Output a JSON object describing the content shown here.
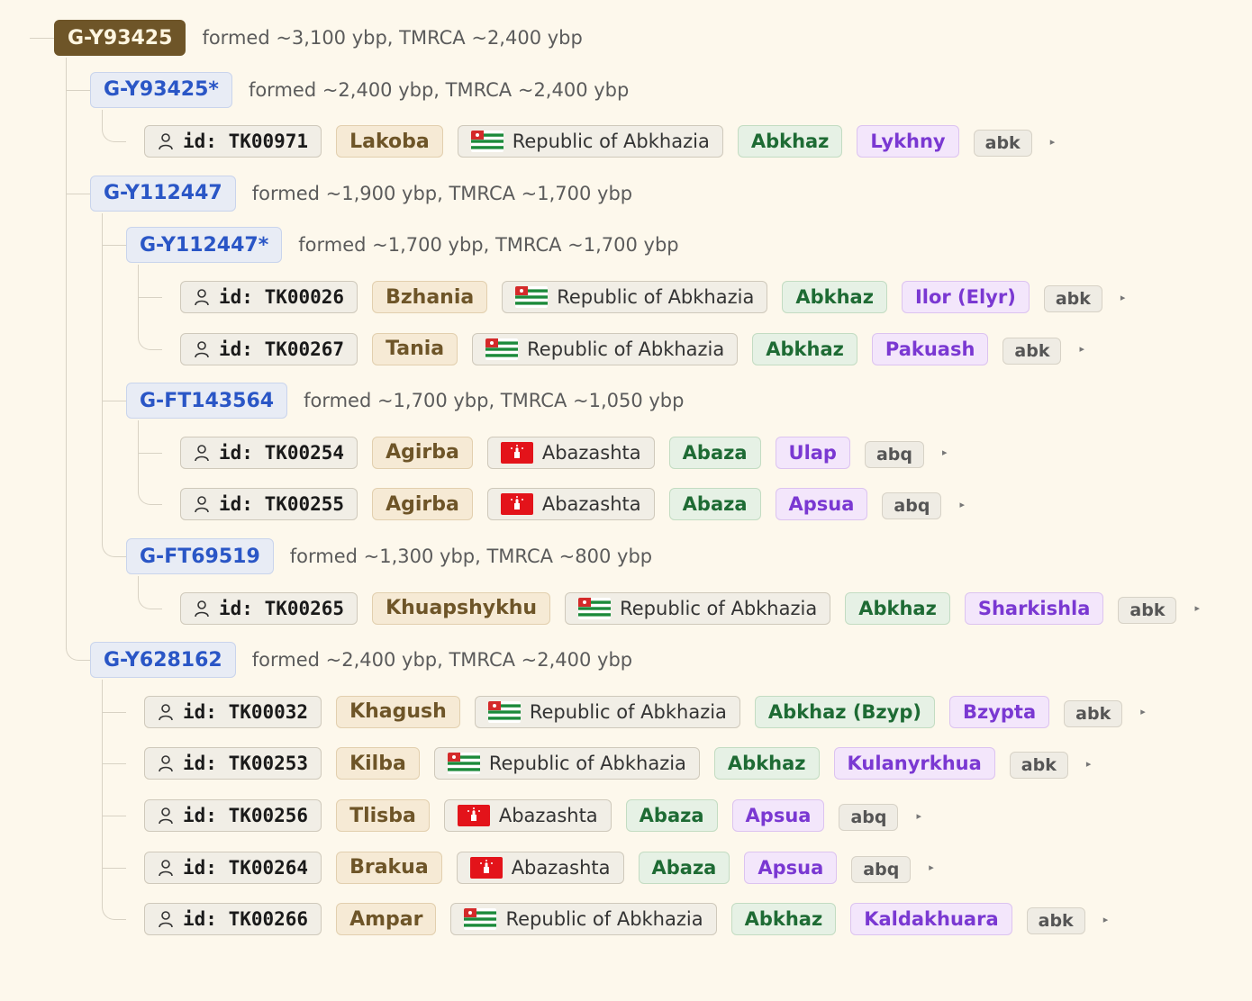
{
  "tree": {
    "clade": "G-Y93425",
    "info": "formed ~3,100 ybp, TMRCA ~2,400 ybp",
    "children": [
      {
        "clade": "G-Y93425*",
        "info": "formed ~2,400 ybp, TMRCA ~2,400 ybp",
        "samples": [
          {
            "id": "id: TK00971",
            "name": "Lakoba",
            "flag": "abkhazia-flag",
            "location": "Republic of Abkhazia",
            "language": "Abkhaz",
            "dialect": "Lykhny",
            "code": "abk"
          }
        ]
      },
      {
        "clade": "G-Y112447",
        "info": "formed ~1,900 ybp, TMRCA ~1,700 ybp",
        "children": [
          {
            "clade": "G-Y112447*",
            "info": "formed ~1,700 ybp, TMRCA ~1,700 ybp",
            "samples": [
              {
                "id": "id: TK00026",
                "name": "Bzhania",
                "flag": "abkhazia-flag",
                "location": "Republic of Abkhazia",
                "language": "Abkhaz",
                "dialect": "Ilor (Elyr)",
                "code": "abk"
              },
              {
                "id": "id: TK00267",
                "name": "Tania",
                "flag": "abkhazia-flag",
                "location": "Republic of Abkhazia",
                "language": "Abkhaz",
                "dialect": "Pakuash",
                "code": "abk"
              }
            ]
          },
          {
            "clade": "G-FT143564",
            "info": "formed ~1,700 ybp, TMRCA ~1,050 ybp",
            "samples": [
              {
                "id": "id: TK00254",
                "name": "Agirba",
                "flag": "abaza-flag",
                "location": "Abazashta",
                "language": "Abaza",
                "dialect": "Ulap",
                "code": "abq"
              },
              {
                "id": "id: TK00255",
                "name": "Agirba",
                "flag": "abaza-flag",
                "location": "Abazashta",
                "language": "Abaza",
                "dialect": "Apsua",
                "code": "abq"
              }
            ]
          },
          {
            "clade": "G-FT69519",
            "info": "formed ~1,300 ybp, TMRCA ~800 ybp",
            "samples": [
              {
                "id": "id: TK00265",
                "name": "Khuapshykhu",
                "flag": "abkhazia-flag",
                "location": "Republic of Abkhazia",
                "language": "Abkhaz",
                "dialect": "Sharkishla",
                "code": "abk"
              }
            ]
          }
        ]
      },
      {
        "clade": "G-Y628162",
        "info": "formed ~2,400 ybp, TMRCA ~2,400 ybp",
        "samples": [
          {
            "id": "id: TK00032",
            "name": "Khagush",
            "flag": "abkhazia-flag",
            "location": "Republic of Abkhazia",
            "language": "Abkhaz (Bzyp)",
            "dialect": "Bzypta",
            "code": "abk"
          },
          {
            "id": "id: TK00253",
            "name": "Kilba",
            "flag": "abkhazia-flag",
            "location": "Republic of Abkhazia",
            "language": "Abkhaz",
            "dialect": "Kulanyrkhua",
            "code": "abk"
          },
          {
            "id": "id: TK00256",
            "name": "Tlisba",
            "flag": "abaza-flag",
            "location": "Abazashta",
            "language": "Abaza",
            "dialect": "Apsua",
            "code": "abq"
          },
          {
            "id": "id: TK00264",
            "name": "Brakua",
            "flag": "abaza-flag",
            "location": "Abazashta",
            "language": "Abaza",
            "dialect": "Apsua",
            "code": "abq"
          },
          {
            "id": "id: TK00266",
            "name": "Ampar",
            "flag": "abkhazia-flag",
            "location": "Republic of Abkhazia",
            "language": "Abkhaz",
            "dialect": "Kaldakhuara",
            "code": "abk"
          }
        ]
      }
    ]
  },
  "icons": {
    "person": "person-icon",
    "expand": "expand-triangle-icon"
  },
  "colors": {
    "background": "#fdf8ec",
    "root_clade": "#6e5528",
    "sub_clade_text": "#2a56c6",
    "language": "#1e6b34",
    "dialect": "#7a38d2"
  }
}
